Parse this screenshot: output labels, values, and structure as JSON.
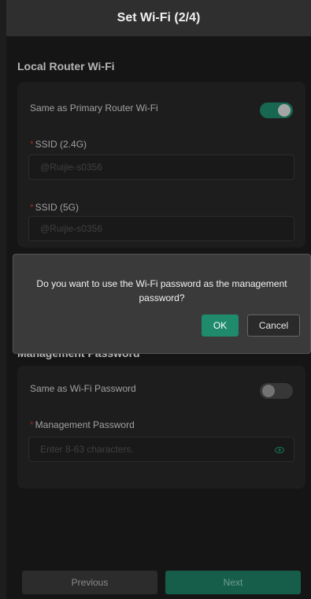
{
  "header": {
    "title": "Set Wi-Fi (2/4)"
  },
  "router_section": {
    "title": "Local Router Wi-Fi",
    "same_as_primary_label": "Same as Primary Router Wi-Fi",
    "same_as_primary_enabled": true,
    "ssid_24_label": "SSID (2.4G)",
    "ssid_24_value": "@Ruijie-s0356",
    "ssid_5_label": "SSID (5G)",
    "ssid_5_value": "@Ruijie-s0356"
  },
  "mgmt_section": {
    "title": "Management Password",
    "same_as_wifi_label": "Same as Wi-Fi Password",
    "same_as_wifi_enabled": false,
    "password_label": "Management Password",
    "password_placeholder": "Enter 8-63 characters."
  },
  "dialog": {
    "message": "Do you want to use the Wi-Fi password as the management password?",
    "ok_label": "OK",
    "cancel_label": "Cancel"
  },
  "footer": {
    "previous_label": "Previous",
    "next_label": "Next"
  },
  "required_mark": "*",
  "colors": {
    "accent": "#1f8a6c",
    "background": "#1d1d1d",
    "card": "#272727",
    "required": "#c0392b"
  }
}
